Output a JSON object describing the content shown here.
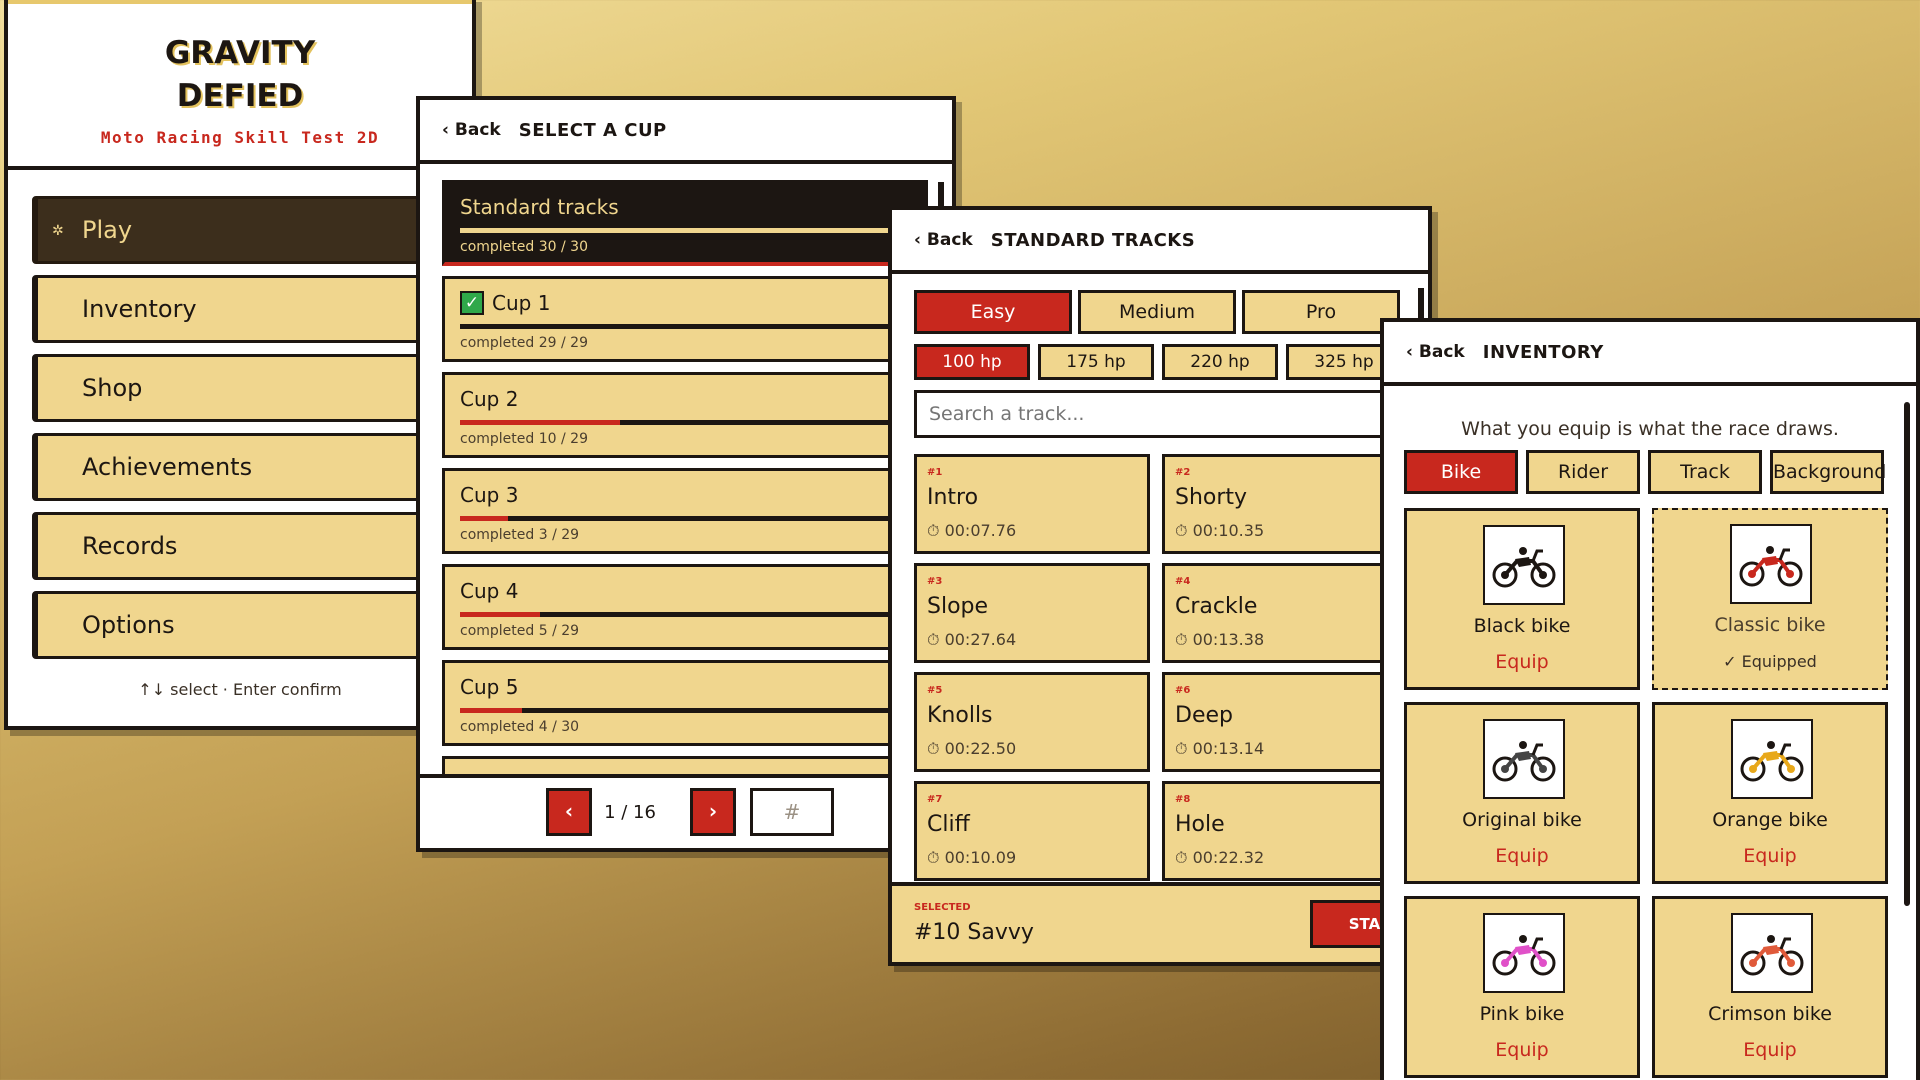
{
  "main_menu": {
    "title_line1": "GRAVITY",
    "title_line2": "DEFIED",
    "subtitle": "Moto Racing Skill Test 2D",
    "items": [
      {
        "label": "Play"
      },
      {
        "label": "Inventory"
      },
      {
        "label": "Shop"
      },
      {
        "label": "Achievements"
      },
      {
        "label": "Records"
      },
      {
        "label": "Options"
      }
    ],
    "hint": "↑↓ select · Enter confirm"
  },
  "cup_select": {
    "back": "‹ Back",
    "title": "SELECT A CUP",
    "cups": [
      {
        "name": "Standard tracks",
        "progress": "completed 30 / 30",
        "fraction": 1.0
      },
      {
        "name": "Cup 1",
        "progress": "completed 29 / 29",
        "fraction": 1.0
      },
      {
        "name": "Cup 2",
        "progress": "completed 10 / 29",
        "fraction": 0.345
      },
      {
        "name": "Cup 3",
        "progress": "completed 3 / 29",
        "fraction": 0.103
      },
      {
        "name": "Cup 4",
        "progress": "completed 5 / 29",
        "fraction": 0.172
      },
      {
        "name": "Cup 5",
        "progress": "completed 4 / 30",
        "fraction": 0.133
      }
    ],
    "prev": "‹",
    "next": "›",
    "page": "1 / 16",
    "page_input_placeholder": "#"
  },
  "tracks": {
    "back": "‹ Back",
    "title": "STANDARD TRACKS",
    "difficulties": [
      "Easy",
      "Medium",
      "Pro"
    ],
    "power": [
      "100 hp",
      "175 hp",
      "220 hp",
      "325 hp"
    ],
    "search_placeholder": "Search a track...",
    "list": [
      {
        "num": "#1",
        "name": "Intro",
        "time": "⏱ 00:07.76"
      },
      {
        "num": "#2",
        "name": "Shorty",
        "time": "⏱ 00:10.35"
      },
      {
        "num": "#3",
        "name": "Slope",
        "time": "⏱ 00:27.64"
      },
      {
        "num": "#4",
        "name": "Crackle",
        "time": "⏱ 00:13.38"
      },
      {
        "num": "#5",
        "name": "Knolls",
        "time": "⏱ 00:22.50"
      },
      {
        "num": "#6",
        "name": "Deep",
        "time": "⏱ 00:13.14"
      },
      {
        "num": "#7",
        "name": "Cliff",
        "time": "⏱ 00:10.09"
      },
      {
        "num": "#8",
        "name": "Hole",
        "time": "⏱ 00:22.32"
      }
    ],
    "selected_label": "SELECTED",
    "selected_value": "#10 Savvy",
    "start": "START"
  },
  "inventory": {
    "back": "‹ Back",
    "title": "INVENTORY",
    "intro": "What you equip is what the race draws.",
    "tabs": [
      "Bike",
      "Rider",
      "Track",
      "Background"
    ],
    "items": [
      {
        "name": "Black bike",
        "action": "Equip",
        "color": "#1c1612"
      },
      {
        "name": "Classic bike",
        "status": "✓ Equipped",
        "color": "#c8281e"
      },
      {
        "name": "Original bike",
        "action": "Equip",
        "color": "#444444"
      },
      {
        "name": "Orange bike",
        "action": "Equip",
        "color": "#e8a81a"
      },
      {
        "name": "Pink bike",
        "action": "Equip",
        "color": "#e050c8"
      },
      {
        "name": "Crimson bike",
        "action": "Equip",
        "color": "#e05a3a"
      }
    ]
  },
  "colors": {
    "accent_red": "#c8281e",
    "cream": "#f0d68e",
    "dark": "#1c1612"
  }
}
